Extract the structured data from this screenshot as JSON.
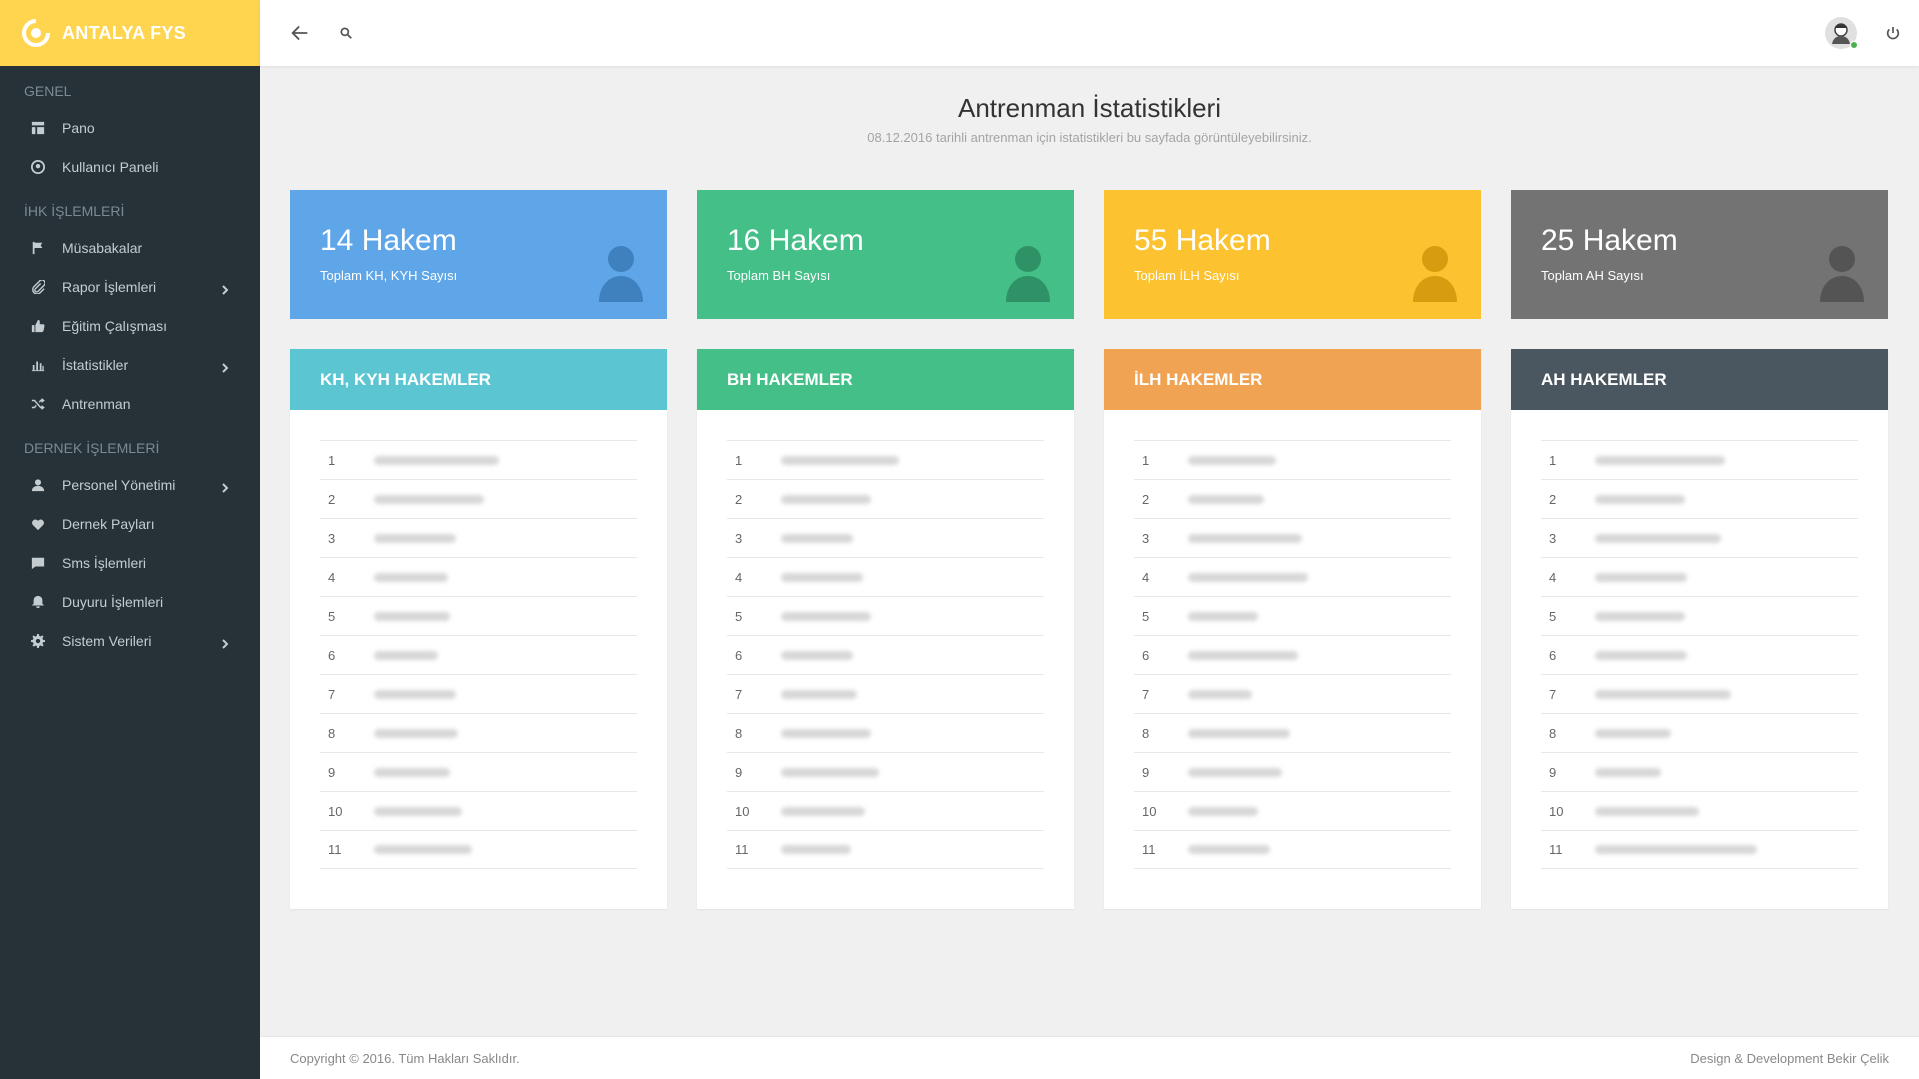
{
  "brand": {
    "name": "ANTALYA FYS"
  },
  "sidebar": {
    "sections": [
      {
        "title": "GENEL",
        "items": [
          {
            "label": "Pano",
            "icon": "dashboard-icon",
            "chevron": false
          },
          {
            "label": "Kullanıcı Paneli",
            "icon": "user-circle-icon",
            "chevron": false
          }
        ]
      },
      {
        "title": "İHK İŞLEMLERİ",
        "items": [
          {
            "label": "Müsabakalar",
            "icon": "flag-icon",
            "chevron": false
          },
          {
            "label": "Rapor İşlemleri",
            "icon": "paperclip-icon",
            "chevron": true
          },
          {
            "label": "Eğitim Çalışması",
            "icon": "thumbs-up-icon",
            "chevron": false
          },
          {
            "label": "İstatistikler",
            "icon": "bar-chart-icon",
            "chevron": true
          },
          {
            "label": "Antrenman",
            "icon": "shuffle-icon",
            "chevron": false
          }
        ]
      },
      {
        "title": "DERNEK İŞLEMLERİ",
        "items": [
          {
            "label": "Personel Yönetimi",
            "icon": "person-icon",
            "chevron": true
          },
          {
            "label": "Dernek Payları",
            "icon": "heart-icon",
            "chevron": false
          },
          {
            "label": "Sms İşlemleri",
            "icon": "message-icon",
            "chevron": false
          },
          {
            "label": "Duyuru İşlemleri",
            "icon": "bell-icon",
            "chevron": false
          },
          {
            "label": "Sistem Verileri",
            "icon": "gear-icon",
            "chevron": true
          }
        ]
      }
    ]
  },
  "page": {
    "title": "Antrenman İstatistikleri",
    "subtitle": "08.12.2016 tarihli antrenman için istatistikleri bu sayfada görüntüleyebilirsiniz."
  },
  "stats": [
    {
      "count": "14 Hakem",
      "label": "Toplam KH, KYH Sayısı",
      "color": "#5fa6e8",
      "icon_color": "#3f80bf"
    },
    {
      "count": "16 Hakem",
      "label": "Toplam BH Sayısı",
      "color": "#43bf87",
      "icon_color": "#2e9266"
    },
    {
      "count": "55 Hakem",
      "label": "Toplam İLH Sayısı",
      "color": "#fcc22f",
      "icon_color": "#d69d10"
    },
    {
      "count": "25 Hakem",
      "label": "Toplam AH Sayısı",
      "color": "#737373",
      "icon_color": "#545454"
    }
  ],
  "panels": [
    {
      "title": "KH, KYH HAKEMLER",
      "color": "#5bc6d2",
      "rows": [
        "1",
        "2",
        "3",
        "4",
        "5",
        "6",
        "7",
        "8",
        "9",
        "10",
        "11"
      ]
    },
    {
      "title": "BH HAKEMLER",
      "color": "#43bf87",
      "rows": [
        "1",
        "2",
        "3",
        "4",
        "5",
        "6",
        "7",
        "8",
        "9",
        "10",
        "11"
      ]
    },
    {
      "title": "İLH HAKEMLER",
      "color": "#f0a453",
      "rows": [
        "1",
        "2",
        "3",
        "4",
        "5",
        "6",
        "7",
        "8",
        "9",
        "10",
        "11"
      ]
    },
    {
      "title": "AH HAKEMLER",
      "color": "#4b5760",
      "rows": [
        "1",
        "2",
        "3",
        "4",
        "5",
        "6",
        "7",
        "8",
        "9",
        "10",
        "11"
      ]
    }
  ],
  "footer": {
    "copyright": "Copyright © 2016. Tüm Hakları Saklıdır.",
    "credit": "Design & Development Bekir Çelik"
  }
}
